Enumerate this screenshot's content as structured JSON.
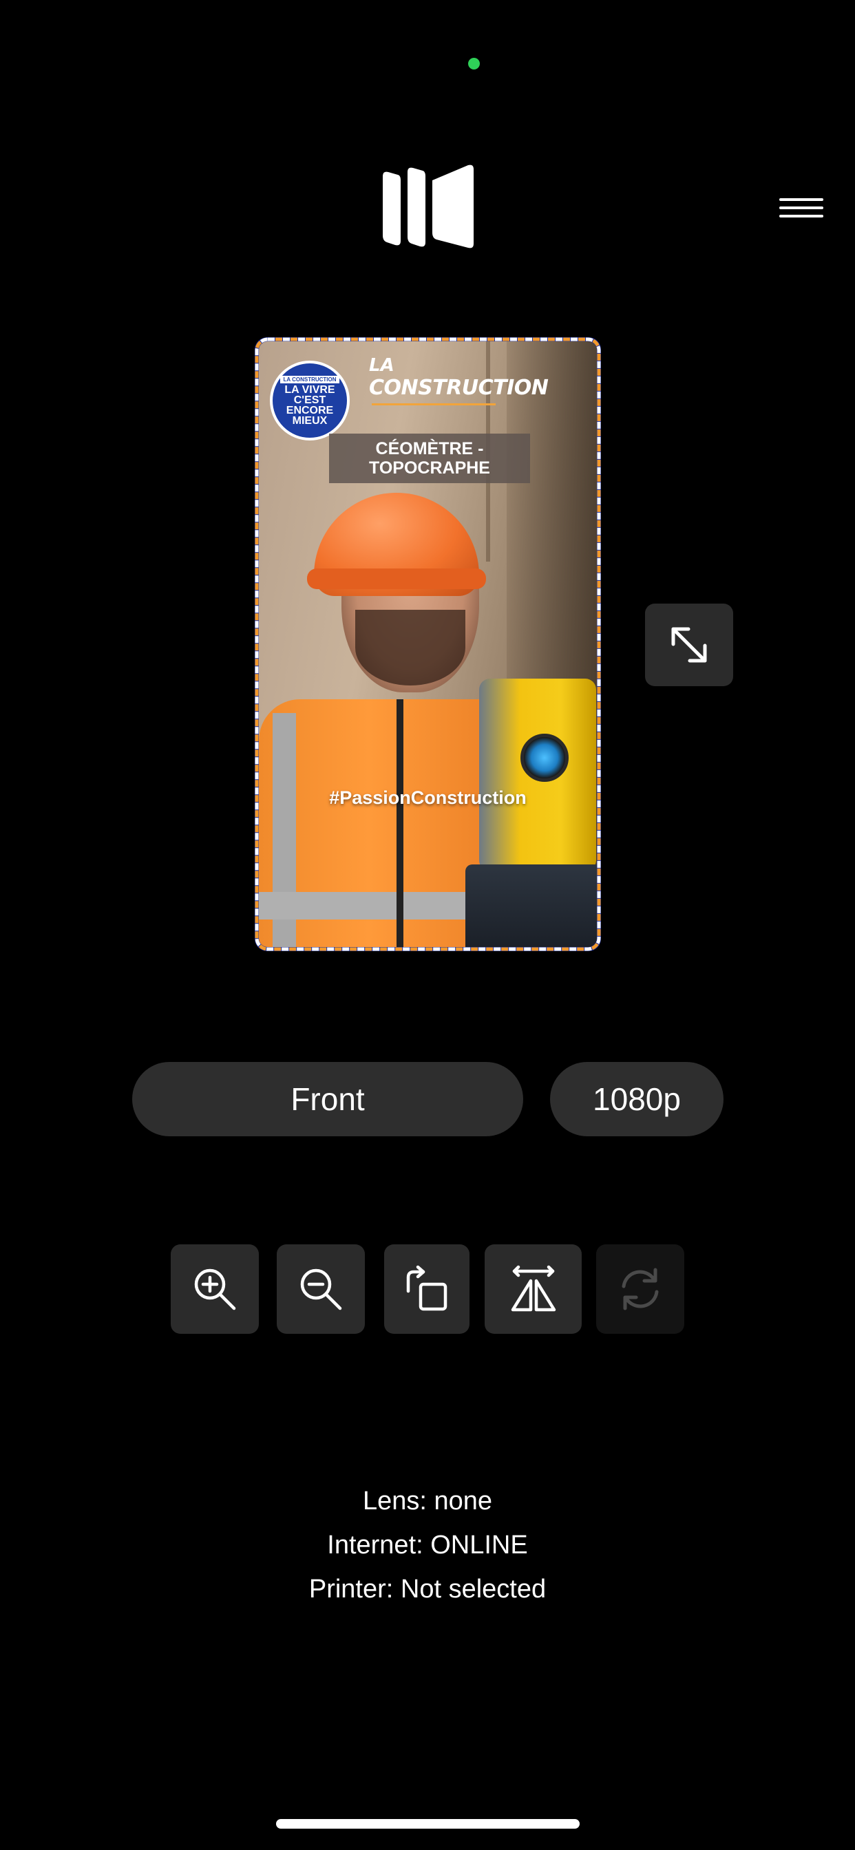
{
  "preview": {
    "badge_top": "LA CONSTRUCTION",
    "badge_text": "LA VIVRE C'EST ENCORE MIEUX",
    "brand_la": "LA",
    "brand_construction": "CONSTRUCTION",
    "job_title_line1": "CÉOMÈTRE -",
    "job_title_line2": "TOPOCRAPHE",
    "hashtag": "#PassionConstruction"
  },
  "controls": {
    "camera_label": "Front",
    "resolution_label": "1080p"
  },
  "tools": [
    {
      "icon": "zoom-in-icon"
    },
    {
      "icon": "zoom-out-icon"
    },
    {
      "icon": "rotate-icon"
    },
    {
      "icon": "flip-horizontal-icon"
    },
    {
      "icon": "refresh-icon",
      "disabled": true
    }
  ],
  "status": {
    "lens": "Lens: none",
    "internet": "Internet: ONLINE",
    "printer": "Printer: Not selected"
  },
  "colors": {
    "background": "#000000",
    "camera_dot": "#2fd158",
    "button_bg": "#2b2b2b",
    "pill_bg": "#2e2e2e"
  }
}
